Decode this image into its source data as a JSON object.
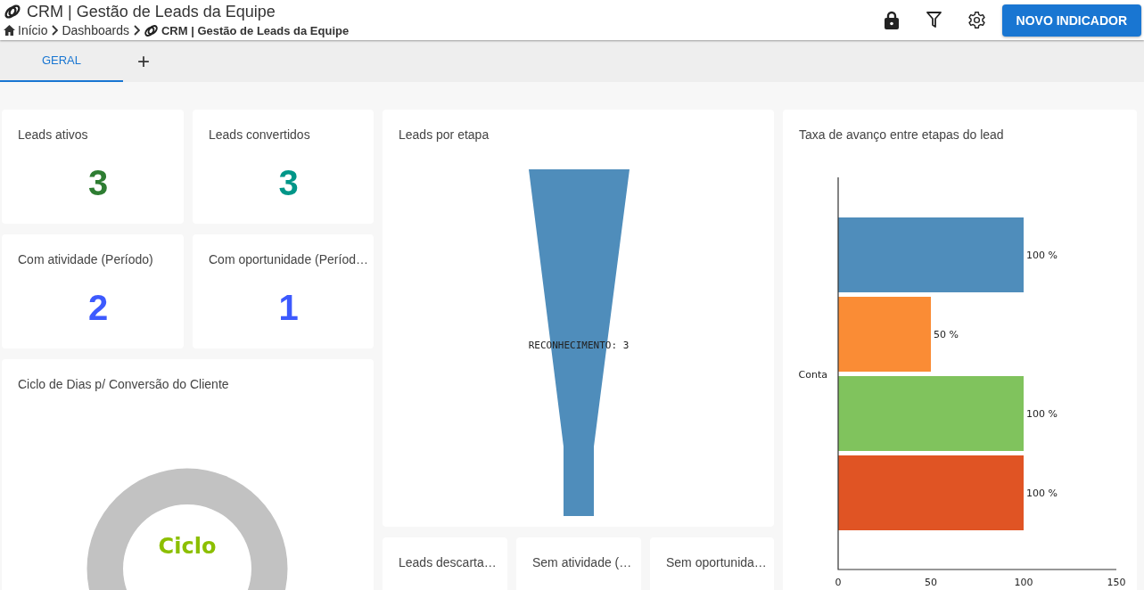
{
  "header": {
    "title": "CRM | Gestão de Leads da Equipe",
    "breadcrumb": [
      {
        "label": "Início",
        "kind": "home"
      },
      {
        "label": "Dashboards",
        "kind": "plain"
      },
      {
        "label": "CRM | Gestão de Leads da Equipe",
        "kind": "current"
      }
    ],
    "action_button": "NOVO INDICADOR"
  },
  "tabs": [
    {
      "label": "GERAL",
      "selected": true
    }
  ],
  "add_tab": "+",
  "kpis": [
    {
      "title": "Leads ativos",
      "value": "3",
      "color": "#2e7d32"
    },
    {
      "title": "Leads convertidos",
      "value": "3",
      "color": "#009688"
    },
    {
      "title": "Com atividade (Período)",
      "value": "2",
      "color": "#3d5afe"
    },
    {
      "title": "Com oportunidade (Períod…",
      "value": "1",
      "color": "#3d5afe"
    }
  ],
  "cycle_card": {
    "title": "Ciclo de Dias p/ Conversão do Cliente",
    "gauge_label": "Ciclo"
  },
  "funnel_card": {
    "title": "Leads por etapa",
    "stage_label": "RECONHECIMENTO: 3",
    "color": "#4f8dbb"
  },
  "small_cards": [
    {
      "title": "Leads descarta…"
    },
    {
      "title": "Sem atividade (…"
    },
    {
      "title": "Sem oportunida…"
    }
  ],
  "rate_card": {
    "title": "Taxa de avanço entre etapas do lead",
    "chart_data": {
      "type": "bar",
      "orientation": "horizontal",
      "categories": [
        "Conta"
      ],
      "series": [
        {
          "color": "#4f8dbb",
          "values": [
            100
          ]
        },
        {
          "color": "#fa8c35",
          "values": [
            50
          ]
        },
        {
          "color": "#80c35d",
          "values": [
            100
          ]
        },
        {
          "color": "#e05424",
          "values": [
            100
          ]
        }
      ],
      "value_labels": [
        "100 %",
        "50 %",
        "100 %",
        "100 %"
      ],
      "xlim": [
        0,
        150
      ],
      "xticks": [
        0,
        50,
        100,
        150
      ]
    }
  }
}
